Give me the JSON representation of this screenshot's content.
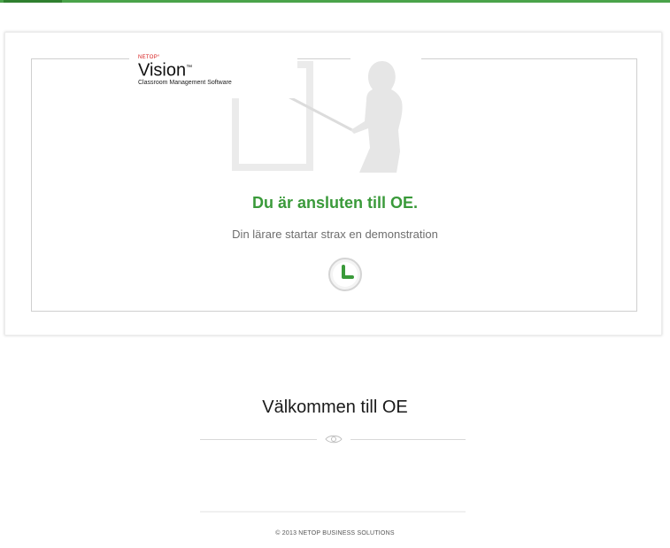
{
  "logo": {
    "brand_small": "NETOP°",
    "brand_big": "Vision",
    "brand_tm": "™",
    "brand_sub": "Classroom Management Software"
  },
  "status": {
    "title": "Du är ansluten till OE.",
    "subtitle": "Din lärare startar strax en demonstration"
  },
  "welcome": {
    "title": "Välkommen till OE"
  },
  "footer": {
    "copyright": "© 2013 NETOP BUSINESS SOLUTIONS"
  },
  "colors": {
    "accent": "#4aa34a",
    "status_title": "#3a9a3a",
    "muted_text": "#6e6e6e"
  },
  "icons": {
    "clock": "clock-icon",
    "eye": "eye-icon"
  }
}
